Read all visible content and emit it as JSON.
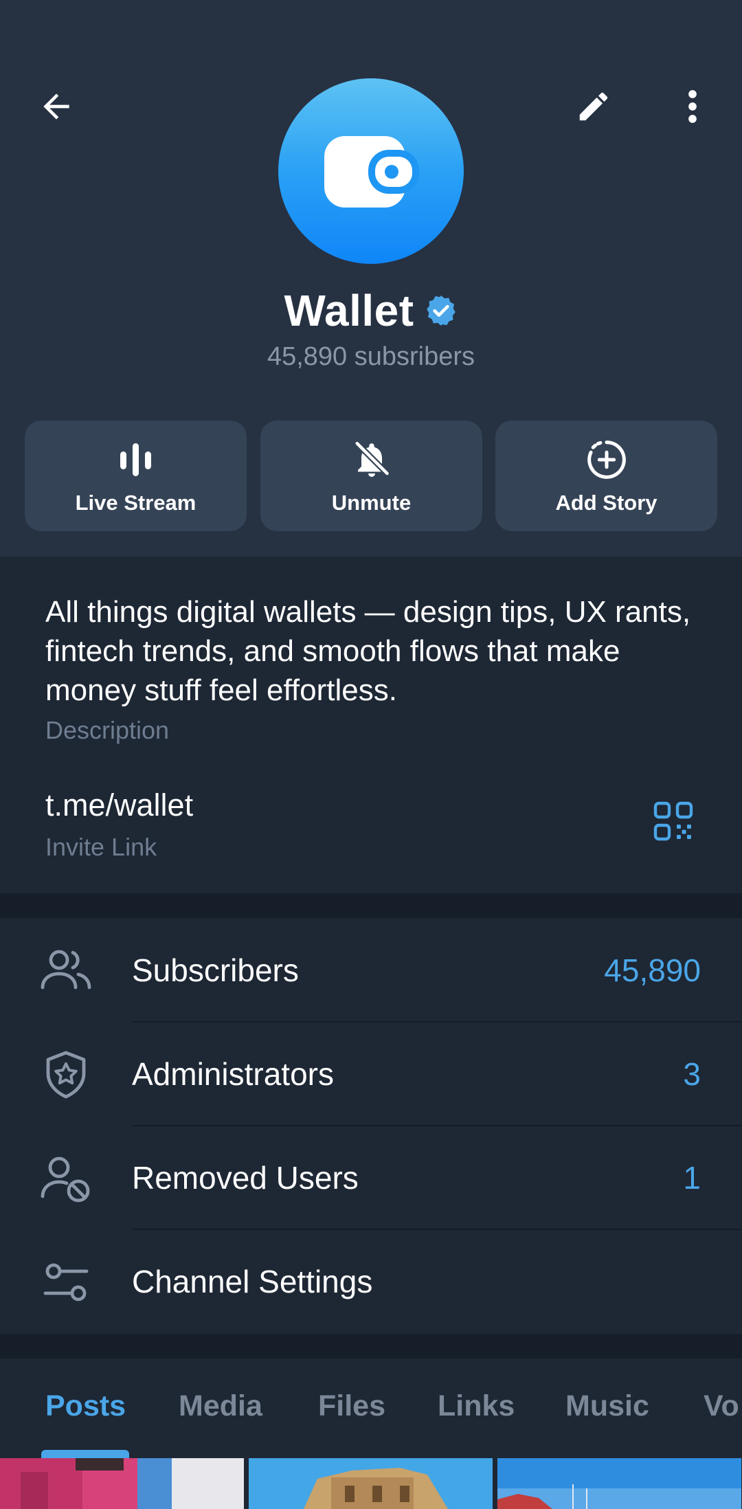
{
  "header": {
    "title": "Wallet",
    "subtitle": "45,890 subsribers",
    "verified": true,
    "avatar_icon": "wallet-icon",
    "actions": [
      {
        "label": "Live Stream",
        "icon": "live-stream-icon"
      },
      {
        "label": "Unmute",
        "icon": "bell-off-icon"
      },
      {
        "label": "Add Story",
        "icon": "add-story-icon"
      }
    ]
  },
  "info": {
    "description": "All things digital wallets — design tips, UX rants, fintech trends, and smooth flows that make money stuff feel effortless.",
    "description_label": "Description",
    "link": "t.me/wallet",
    "link_label": "Invite Link"
  },
  "menu": [
    {
      "label": "Subscribers",
      "value": "45,890",
      "icon": "people-icon"
    },
    {
      "label": "Administrators",
      "value": "3",
      "icon": "shield-star-icon"
    },
    {
      "label": "Removed Users",
      "value": "1",
      "icon": "user-blocked-icon"
    },
    {
      "label": "Channel Settings",
      "value": "",
      "icon": "settings-sliders-icon"
    }
  ],
  "tabs": [
    "Posts",
    "Media",
    "Files",
    "Links",
    "Music",
    "Vo"
  ],
  "active_tab": "Posts",
  "colors": {
    "accent": "#4aa6e8",
    "background": "#1e2734",
    "header_background": "#263142",
    "button_background": "#354356"
  }
}
